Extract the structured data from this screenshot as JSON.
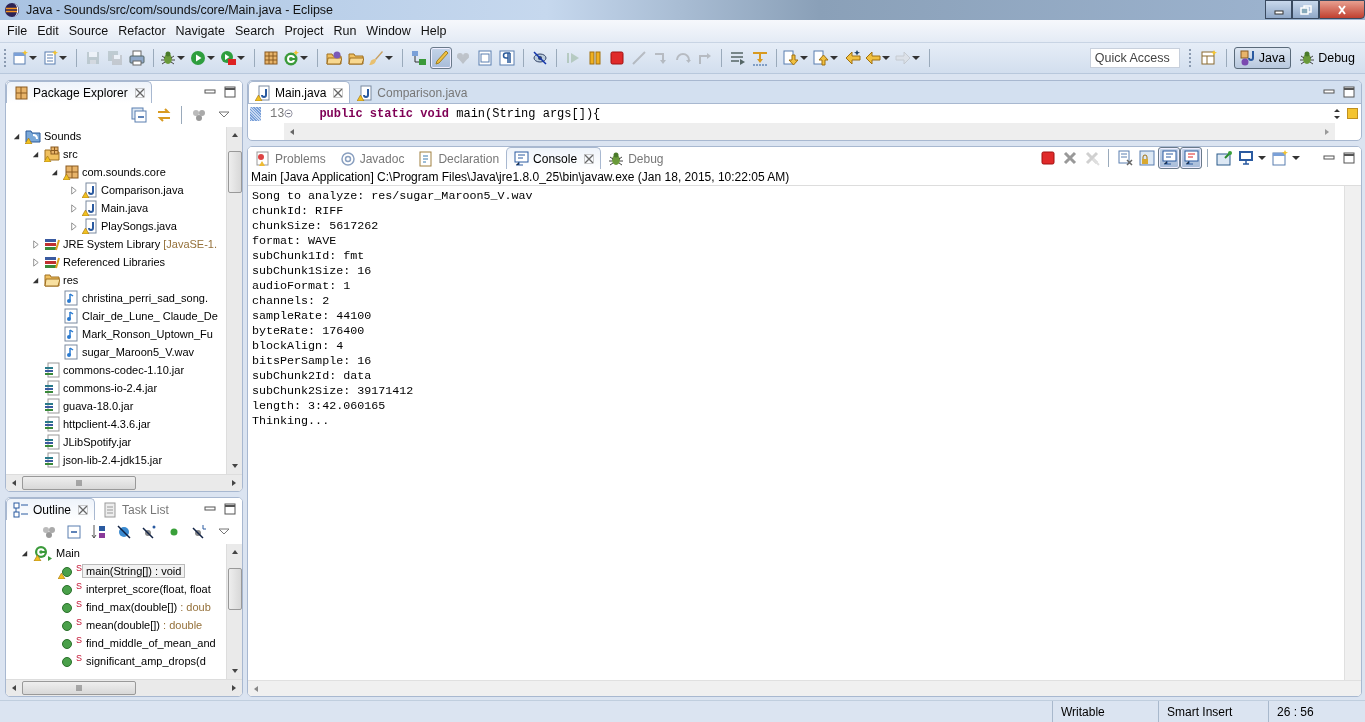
{
  "window": {
    "title": "Java - Sounds/src/com/sounds/core/Main.java - Eclipse"
  },
  "menu": [
    "File",
    "Edit",
    "Source",
    "Refactor",
    "Navigate",
    "Search",
    "Project",
    "Run",
    "Window",
    "Help"
  ],
  "toolbar": {
    "groups": [
      [
        {
          "kind": "new-file",
          "dropdown": true,
          "disabled": false,
          "pressed": false
        },
        {
          "kind": "new-list",
          "dropdown": true,
          "disabled": false,
          "pressed": false
        }
      ],
      [
        {
          "kind": "save",
          "dropdown": false,
          "disabled": true,
          "pressed": false
        },
        {
          "kind": "save-all",
          "dropdown": false,
          "disabled": true,
          "pressed": false
        },
        {
          "kind": "print",
          "dropdown": false,
          "disabled": false,
          "pressed": false
        }
      ],
      [
        {
          "kind": "bug",
          "dropdown": true,
          "disabled": false,
          "pressed": false
        },
        {
          "kind": "run",
          "dropdown": true,
          "disabled": false,
          "pressed": false
        },
        {
          "kind": "run-tool",
          "dropdown": true,
          "disabled": false,
          "pressed": false
        }
      ],
      [
        {
          "kind": "package",
          "dropdown": false,
          "disabled": false,
          "pressed": false
        },
        {
          "kind": "new-class",
          "dropdown": true,
          "disabled": false,
          "pressed": false
        }
      ],
      [
        {
          "kind": "folder-globe",
          "dropdown": false,
          "disabled": false,
          "pressed": false
        },
        {
          "kind": "folder",
          "dropdown": false,
          "disabled": false,
          "pressed": false
        },
        {
          "kind": "brush",
          "dropdown": true,
          "disabled": false,
          "pressed": false
        }
      ],
      [
        {
          "kind": "hierarchy",
          "dropdown": false,
          "disabled": false,
          "pressed": false
        },
        {
          "kind": "pen",
          "dropdown": false,
          "disabled": false,
          "pressed": true
        },
        {
          "kind": "hearts",
          "dropdown": false,
          "disabled": true,
          "pressed": false
        },
        {
          "kind": "block",
          "dropdown": false,
          "disabled": false,
          "pressed": false
        },
        {
          "kind": "pilcrow",
          "dropdown": false,
          "disabled": false,
          "pressed": false
        }
      ],
      [
        {
          "kind": "eye-strike",
          "dropdown": false,
          "disabled": false,
          "pressed": false
        }
      ],
      [
        {
          "kind": "resume",
          "dropdown": false,
          "disabled": true,
          "pressed": false
        },
        {
          "kind": "pause",
          "dropdown": false,
          "disabled": false,
          "pressed": false
        },
        {
          "kind": "stop",
          "dropdown": false,
          "disabled": false,
          "pressed": false
        },
        {
          "kind": "disconnect",
          "dropdown": false,
          "disabled": true,
          "pressed": false
        },
        {
          "kind": "step-into",
          "dropdown": false,
          "disabled": true,
          "pressed": false
        },
        {
          "kind": "step-over",
          "dropdown": false,
          "disabled": true,
          "pressed": false
        },
        {
          "kind": "step-return",
          "dropdown": false,
          "disabled": true,
          "pressed": false
        }
      ],
      [
        {
          "kind": "lines",
          "dropdown": false,
          "disabled": false,
          "pressed": false
        },
        {
          "kind": "step-filter",
          "dropdown": false,
          "disabled": false,
          "pressed": false
        }
      ],
      [
        {
          "kind": "next",
          "dropdown": true,
          "disabled": false,
          "pressed": false
        },
        {
          "kind": "prev",
          "dropdown": true,
          "disabled": false,
          "pressed": false
        },
        {
          "kind": "last-edit",
          "dropdown": false,
          "disabled": false,
          "pressed": false
        },
        {
          "kind": "back",
          "dropdown": true,
          "disabled": false,
          "pressed": false
        },
        {
          "kind": "forward",
          "dropdown": true,
          "disabled": true,
          "pressed": false
        }
      ]
    ],
    "quick_access": {
      "placeholder": "Quick Access"
    },
    "perspectives": [
      {
        "label": "Java",
        "kind": "java",
        "selected": true
      },
      {
        "label": "Debug",
        "kind": "debug",
        "selected": false
      }
    ]
  },
  "package_explorer": {
    "tabs": [
      {
        "label": "Package Explorer",
        "selected": true
      }
    ],
    "tree": [
      {
        "label": "Sounds",
        "kind": "project",
        "warning": true,
        "expanded": true,
        "children": [
          {
            "label": "src",
            "kind": "source-folder",
            "warning": true,
            "expanded": true,
            "children": [
              {
                "label": "com.sounds.core",
                "kind": "package",
                "warning": true,
                "expanded": true,
                "children": [
                  {
                    "label": "Comparison.java",
                    "kind": "java-file",
                    "warning": true,
                    "expanded": false
                  },
                  {
                    "label": "Main.java",
                    "kind": "java-file",
                    "warning": true,
                    "expanded": false
                  },
                  {
                    "label": "PlaySongs.java",
                    "kind": "java-file",
                    "warning": true,
                    "expanded": false
                  }
                ]
              }
            ]
          },
          {
            "label": "JRE System Library",
            "decoration": "[JavaSE-1.",
            "kind": "library",
            "warning": false,
            "expanded": false
          },
          {
            "label": "Referenced Libraries",
            "kind": "library",
            "warning": false,
            "expanded": false
          },
          {
            "label": "res",
            "kind": "folder",
            "warning": false,
            "expanded": true,
            "children": [
              {
                "label": "christina_perri_sad_song.",
                "kind": "audio-file",
                "warning": false
              },
              {
                "label": "Clair_de_Lune_ Claude_De",
                "kind": "audio-file",
                "warning": false
              },
              {
                "label": "Mark_Ronson_Uptown_Fu",
                "kind": "audio-file",
                "warning": false
              },
              {
                "label": "sugar_Maroon5_V.wav",
                "kind": "audio-file",
                "warning": false
              }
            ]
          },
          {
            "label": "commons-codec-1.10.jar",
            "kind": "jar",
            "warning": false
          },
          {
            "label": "commons-io-2.4.jar",
            "kind": "jar",
            "warning": false
          },
          {
            "label": "guava-18.0.jar",
            "kind": "jar",
            "warning": false
          },
          {
            "label": "httpclient-4.3.6.jar",
            "kind": "jar",
            "warning": false
          },
          {
            "label": "JLibSpotify.jar",
            "kind": "jar",
            "warning": false
          },
          {
            "label": "json-lib-2.4-jdk15.jar",
            "kind": "jar",
            "warning": false
          }
        ]
      }
    ]
  },
  "outline": {
    "tabs": [
      {
        "label": "Outline",
        "selected": true
      },
      {
        "label": "Task List",
        "selected": false
      }
    ],
    "root": {
      "label": "Main",
      "expanded": true,
      "warning": true
    },
    "members": [
      {
        "signature": "main(String[])",
        "return_type": " : void",
        "modifier": "S",
        "warning": true,
        "selected": true
      },
      {
        "signature": "interpret_score(float, float",
        "modifier": "S",
        "warning": false,
        "selected": false
      },
      {
        "signature": "find_max(double[])",
        "return_type": " : doub",
        "modifier": "S",
        "warning": false,
        "selected": false
      },
      {
        "signature": "mean(double[])",
        "return_type": " : double",
        "modifier": "S",
        "warning": false,
        "selected": false
      },
      {
        "signature": "find_middle_of_mean_and",
        "modifier": "S",
        "warning": false,
        "selected": false
      },
      {
        "signature": "significant_amp_drops(d",
        "modifier": "S",
        "warning": false,
        "selected": false
      }
    ]
  },
  "editor": {
    "tabs": [
      {
        "label": "Main.java",
        "selected": true
      },
      {
        "label": "Comparison.java",
        "selected": false
      }
    ],
    "line_number": "13",
    "code": [
      {
        "text": "public ",
        "kind": "keyword"
      },
      {
        "text": "static ",
        "kind": "keyword"
      },
      {
        "text": "void ",
        "kind": "keyword"
      },
      {
        "text": "main(String args[]){",
        "kind": "plain"
      }
    ]
  },
  "console": {
    "tabs": [
      {
        "label": "Problems",
        "kind": "problems",
        "selected": false
      },
      {
        "label": "Javadoc",
        "kind": "javadoc",
        "selected": false
      },
      {
        "label": "Declaration",
        "kind": "declaration",
        "selected": false
      },
      {
        "label": "Console",
        "kind": "console",
        "selected": true
      },
      {
        "label": "Debug",
        "kind": "debug",
        "selected": false
      }
    ],
    "toolbar": [
      [
        {
          "kind": "stop",
          "disabled": false,
          "pressed": false
        },
        {
          "kind": "remove",
          "disabled": false,
          "pressed": false
        },
        {
          "kind": "remove-all",
          "disabled": true,
          "pressed": false
        }
      ],
      [
        {
          "kind": "clear",
          "disabled": false,
          "pressed": false
        },
        {
          "kind": "lock",
          "disabled": false,
          "pressed": false
        },
        {
          "kind": "console-out",
          "disabled": false,
          "pressed": true
        },
        {
          "kind": "console-err",
          "disabled": false,
          "pressed": true
        }
      ],
      [
        {
          "kind": "pin",
          "disabled": false,
          "pressed": false
        },
        {
          "kind": "monitor",
          "disabled": false,
          "pressed": false
        },
        {
          "kind": "new-window",
          "disabled": false,
          "pressed": false
        }
      ]
    ],
    "process": "Main [Java Application] C:\\Program Files\\Java\\jre1.8.0_25\\bin\\javaw.exe (Jan 18, 2015, 10:22:05 AM)",
    "lines": [
      "Song to analyze: res/sugar_Maroon5_V.wav",
      "chunkId: RIFF",
      "chunkSize: 5617262",
      "format: WAVE",
      "subChunk1Id: fmt",
      "subChunk1Size: 16",
      "audioFormat: 1",
      "channels: 2",
      "sampleRate: 44100",
      "byteRate: 176400",
      "blockAlign: 4",
      "bitsPerSample: 16",
      "subChunk2Id: data",
      "subChunk2Size: 39171412",
      "length: 3:42.060165",
      "Thinking..."
    ]
  },
  "status_bar": [
    "Writable",
    "Smart Insert",
    "26 : 56"
  ]
}
